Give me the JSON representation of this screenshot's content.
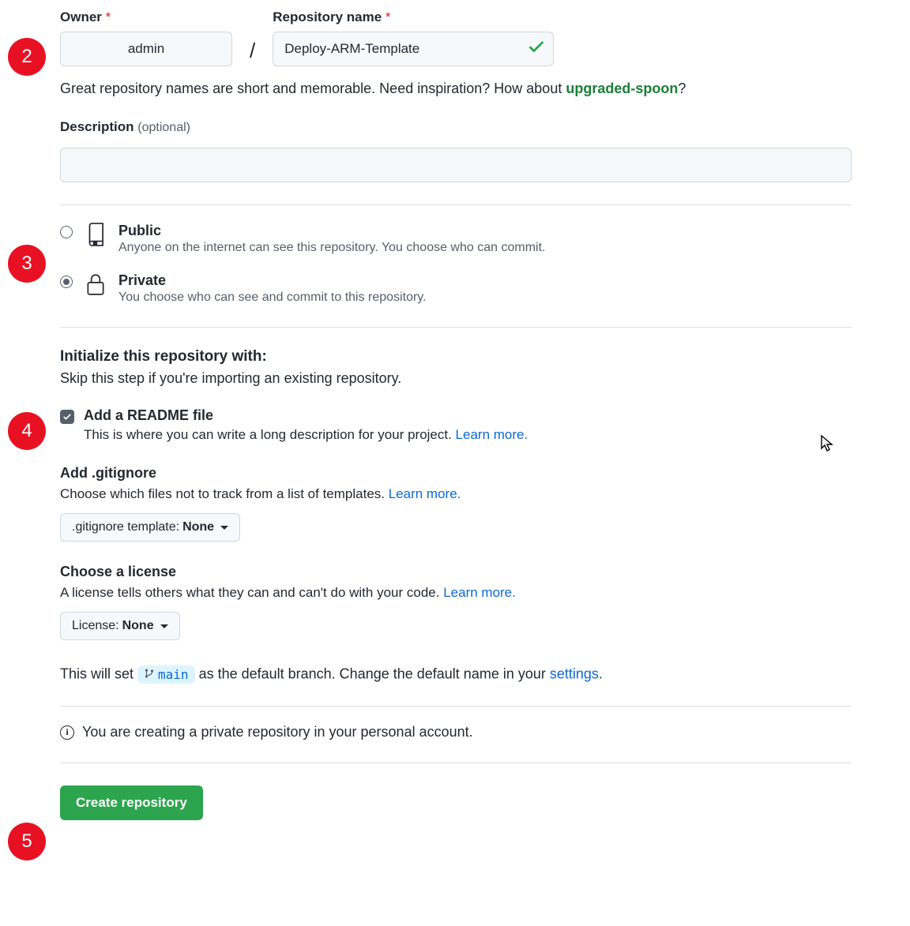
{
  "callouts": {
    "c2": "2",
    "c3": "3",
    "c4": "4",
    "c5": "5"
  },
  "labels": {
    "owner": "Owner",
    "repoName": "Repository name",
    "description": "Description",
    "optional": "(optional)"
  },
  "owner": {
    "value": "admin"
  },
  "repo": {
    "value": "Deploy-ARM-Template"
  },
  "hint": {
    "pre": "Great repository names are short and memorable. Need inspiration? How about ",
    "suggestion": "upgraded-spoon",
    "post": "?"
  },
  "visibility": {
    "public": {
      "title": "Public",
      "desc": "Anyone on the internet can see this repository. You choose who can commit."
    },
    "private": {
      "title": "Private",
      "desc": "You choose who can see and commit to this repository."
    },
    "selected": "private"
  },
  "init": {
    "title": "Initialize this repository with:",
    "skip": "Skip this step if you're importing an existing repository."
  },
  "readme": {
    "title": "Add a README file",
    "descPre": "This is where you can write a long description for your project. ",
    "learn": "Learn more.",
    "checked": true
  },
  "gitignore": {
    "title": "Add .gitignore",
    "descPre": "Choose which files not to track from a list of templates. ",
    "learn": "Learn more.",
    "ddLabel": ".gitignore template: ",
    "ddValue": "None"
  },
  "license": {
    "title": "Choose a license",
    "descPre": "A license tells others what they can and can't do with your code. ",
    "learn": "Learn more.",
    "ddLabel": "License: ",
    "ddValue": "None"
  },
  "branchNote": {
    "pre": "This will set ",
    "branch": "main",
    "mid": " as the default branch. Change the default name in your ",
    "link": "settings",
    "post": "."
  },
  "finalNote": "You are creating a private repository in your personal account.",
  "createBtn": "Create repository"
}
